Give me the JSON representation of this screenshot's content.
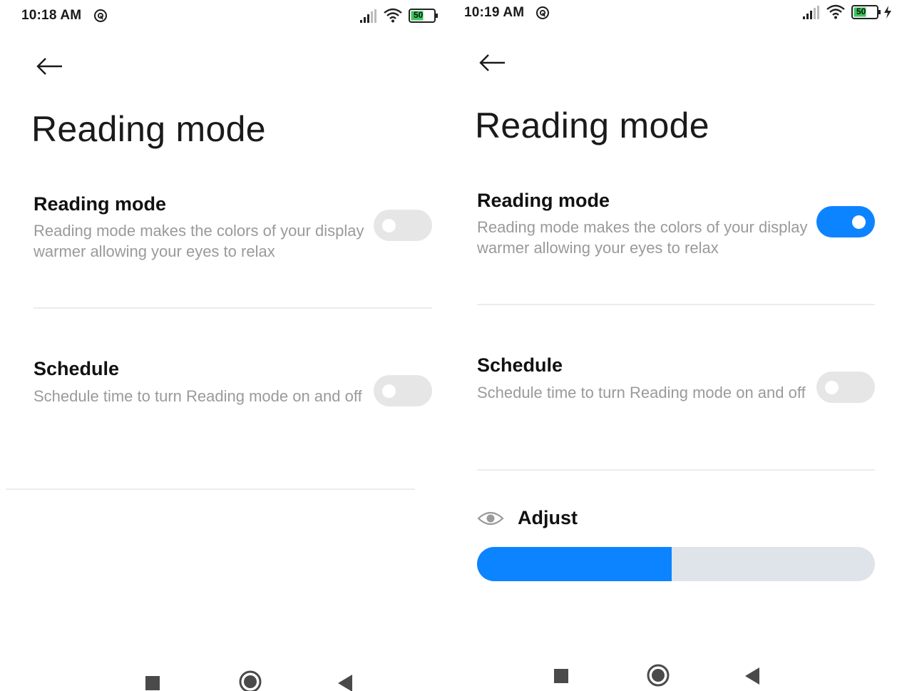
{
  "left_screen": {
    "status_bar": {
      "time": "10:18 AM",
      "battery_level": "50"
    },
    "page_title": "Reading mode",
    "reading_mode": {
      "title": "Reading mode",
      "description": "Reading mode makes the colors of your display warmer allowing your eyes to relax",
      "enabled": false
    },
    "schedule": {
      "title": "Schedule",
      "description": "Schedule time to turn Reading mode on and off",
      "enabled": false
    }
  },
  "right_screen": {
    "status_bar": {
      "time": "10:19 AM",
      "battery_level": "50",
      "charging": true
    },
    "page_title": "Reading mode",
    "reading_mode": {
      "title": "Reading mode",
      "description": "Reading mode makes the colors of your display warmer allowing your eyes to relax",
      "enabled": true
    },
    "schedule": {
      "title": "Schedule",
      "description": "Schedule time to turn Reading mode on and off",
      "enabled": false
    },
    "adjust": {
      "label": "Adjust",
      "level": 0.49
    }
  },
  "icons": {
    "back": "back-arrow-icon",
    "notification": "notification-icon",
    "signal": "signal-icon",
    "wifi": "wifi-icon",
    "battery": "battery-icon",
    "charging": "charging-bolt-icon",
    "eye": "eye-icon",
    "nav_recent": "recent-apps-icon",
    "nav_home": "home-icon",
    "nav_back": "back-triangle-icon"
  },
  "colors": {
    "accent": "#0d84ff",
    "toggle_off": "#e6e6e6",
    "slider_track": "#dfe3ea",
    "subtitle_text": "#9a9a9a",
    "battery_green": "#3cc55a"
  }
}
